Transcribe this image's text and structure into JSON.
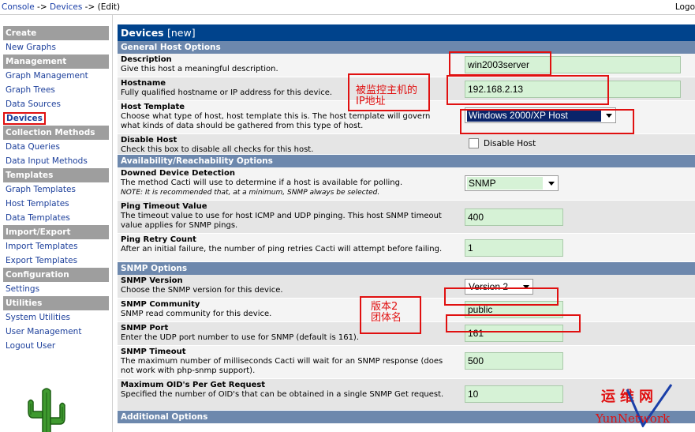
{
  "breadcrumb": {
    "console": "Console",
    "sep1": " -> ",
    "devices": "Devices",
    "sep2": " -> ",
    "edit": "(Edit)"
  },
  "top_right": "Logo",
  "sidebar": [
    {
      "type": "header",
      "label": "Create"
    },
    {
      "type": "link",
      "label": "New Graphs"
    },
    {
      "type": "header",
      "label": "Management"
    },
    {
      "type": "link",
      "label": "Graph Management"
    },
    {
      "type": "link",
      "label": "Graph Trees"
    },
    {
      "type": "link",
      "label": "Data Sources"
    },
    {
      "type": "link",
      "label": "Devices",
      "active": true
    },
    {
      "type": "header",
      "label": "Collection Methods"
    },
    {
      "type": "link",
      "label": "Data Queries"
    },
    {
      "type": "link",
      "label": "Data Input Methods"
    },
    {
      "type": "header",
      "label": "Templates"
    },
    {
      "type": "link",
      "label": "Graph Templates"
    },
    {
      "type": "link",
      "label": "Host Templates"
    },
    {
      "type": "link",
      "label": "Data Templates"
    },
    {
      "type": "header",
      "label": "Import/Export"
    },
    {
      "type": "link",
      "label": "Import Templates"
    },
    {
      "type": "link",
      "label": "Export Templates"
    },
    {
      "type": "header",
      "label": "Configuration"
    },
    {
      "type": "link",
      "label": "Settings"
    },
    {
      "type": "header",
      "label": "Utilities"
    },
    {
      "type": "link",
      "label": "System Utilities"
    },
    {
      "type": "link",
      "label": "User Management"
    },
    {
      "type": "link",
      "label": "Logout User"
    }
  ],
  "main": {
    "title": "Devices",
    "title_sub": "[new]",
    "sections": {
      "general": "General Host Options",
      "availability": "Availability/Reachability Options",
      "snmp": "SNMP Options",
      "additional": "Additional Options"
    },
    "fields": {
      "description": {
        "label": "Description",
        "help": "Give this host a meaningful description.",
        "value": "win2003server"
      },
      "hostname": {
        "label": "Hostname",
        "help": "Fully qualified hostname or IP address for this device.",
        "value": "192.168.2.13"
      },
      "host_template": {
        "label": "Host Template",
        "help": "Choose what type of host, host template this is. The host template will govern what kinds of data should be gathered from this type of host.",
        "value": "Windows 2000/XP Host"
      },
      "disable_host": {
        "label": "Disable Host",
        "help": "Check this box to disable all checks for this host.",
        "checkbox_label": "Disable Host"
      },
      "downed_detection": {
        "label": "Downed Device Detection",
        "help": "The method Cacti will use to determine if a host is available for polling.",
        "note": "NOTE: It is recommended that, at a minimum, SNMP always be selected.",
        "value": "SNMP"
      },
      "ping_timeout": {
        "label": "Ping Timeout Value",
        "help": "The timeout value to use for host ICMP and UDP pinging. This host SNMP timeout value applies for SNMP pings.",
        "value": "400"
      },
      "ping_retry": {
        "label": "Ping Retry Count",
        "help": "After an initial failure, the number of ping retries Cacti will attempt before failing.",
        "value": "1"
      },
      "snmp_version": {
        "label": "SNMP Version",
        "help": "Choose the SNMP version for this device.",
        "value": "Version 2"
      },
      "snmp_community": {
        "label": "SNMP Community",
        "help": "SNMP read community for this device.",
        "value": "public"
      },
      "snmp_port": {
        "label": "SNMP Port",
        "help": "Enter the UDP port number to use for SNMP (default is 161).",
        "value": "161"
      },
      "snmp_timeout": {
        "label": "SNMP Timeout",
        "help": "The maximum number of milliseconds Cacti will wait for an SNMP response (does not work with php-snmp support).",
        "value": "500"
      },
      "max_oids": {
        "label": "Maximum OID's Per Get Request",
        "help": "Specified the number of OID's that can be obtained in a single SNMP Get request.",
        "value": "10"
      }
    }
  },
  "annotations": {
    "ip_note_line1": "被监控主机的",
    "ip_note_line2": "IP地址",
    "snmp_note_line1": "版本2",
    "snmp_note_line2": "团体名"
  },
  "watermark": {
    "top": "运维网",
    "bottom": "YunNetwork"
  },
  "colors": {
    "title_bg": "#00438c",
    "section_bg": "#6d88ad",
    "sidebar_header": "#9e9e9e",
    "input_bg": "#d6f2d6",
    "annotation_red": "#e01010",
    "link": "#1c3f9b"
  }
}
